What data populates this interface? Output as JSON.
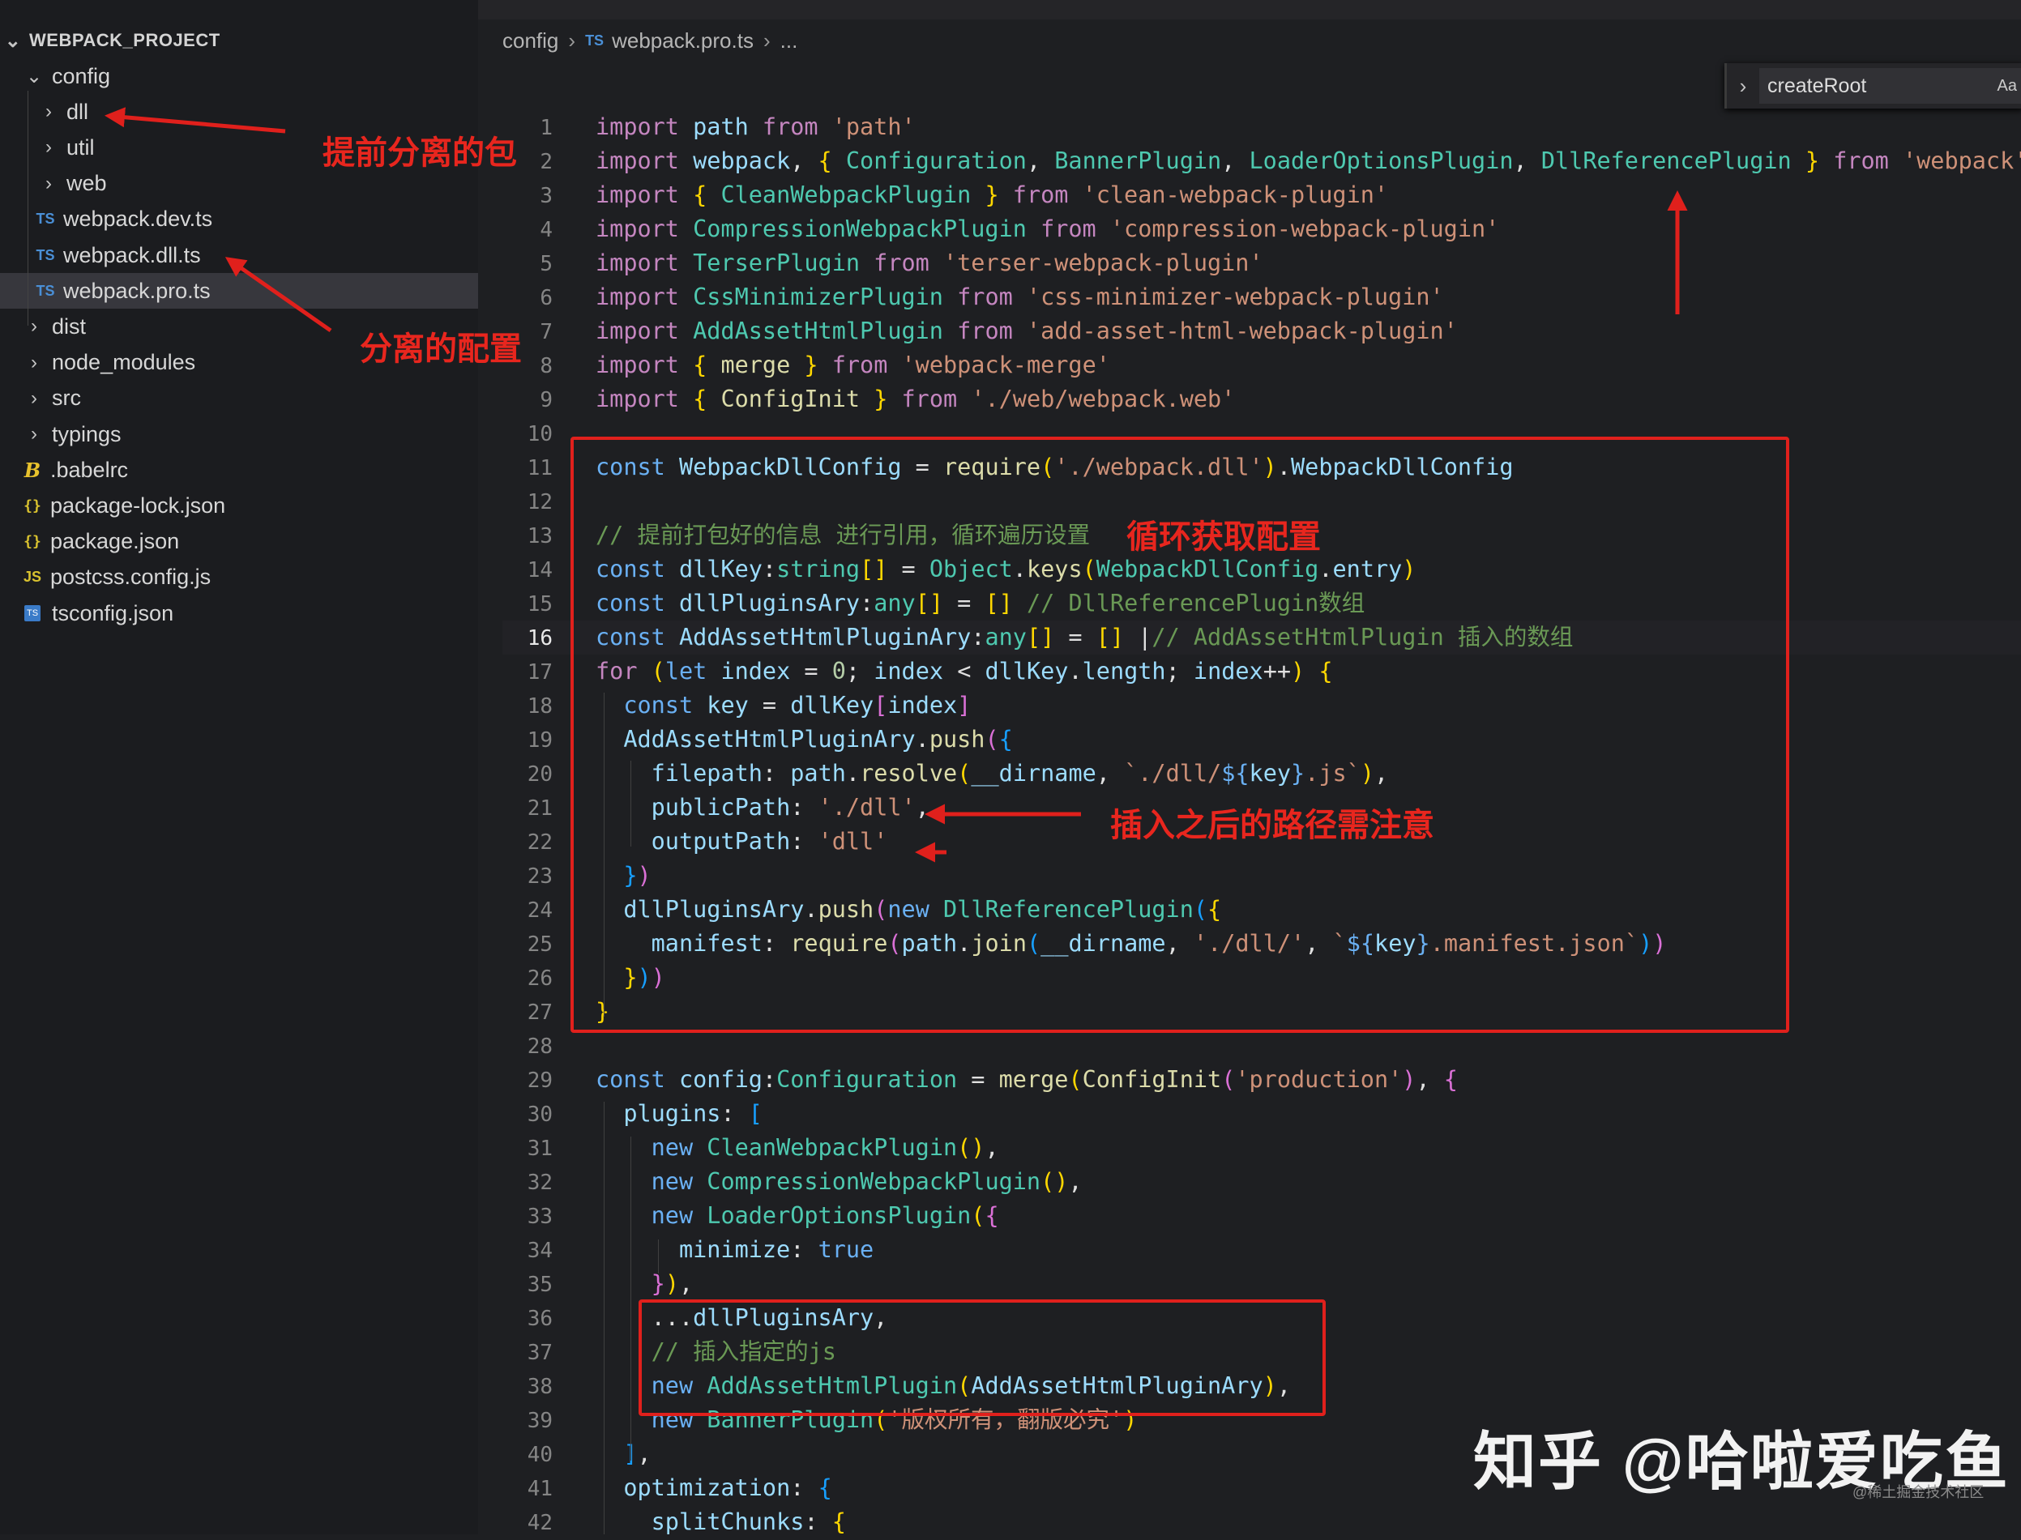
{
  "explorer": {
    "project_title": "WEBPACK_PROJECT",
    "items": [
      {
        "label": "config",
        "kind": "folder",
        "open": true,
        "depth": 0
      },
      {
        "label": "dll",
        "kind": "folder",
        "open": false,
        "depth": 1
      },
      {
        "label": "util",
        "kind": "folder",
        "open": false,
        "depth": 1
      },
      {
        "label": "web",
        "kind": "folder",
        "open": false,
        "depth": 1
      },
      {
        "label": "webpack.dev.ts",
        "kind": "ts",
        "icon": "TS",
        "depth": 1
      },
      {
        "label": "webpack.dll.ts",
        "kind": "ts",
        "icon": "TS",
        "depth": 1
      },
      {
        "label": "webpack.pro.ts",
        "kind": "ts",
        "icon": "TS",
        "depth": 1,
        "selected": true
      },
      {
        "label": "dist",
        "kind": "folder",
        "open": false,
        "depth": 0
      },
      {
        "label": "node_modules",
        "kind": "folder",
        "open": false,
        "depth": 0
      },
      {
        "label": "src",
        "kind": "folder",
        "open": false,
        "depth": 0
      },
      {
        "label": "typings",
        "kind": "folder",
        "open": false,
        "depth": 0
      },
      {
        "label": ".babelrc",
        "kind": "babel",
        "icon": "B",
        "depth": 0
      },
      {
        "label": "package-lock.json",
        "kind": "json",
        "icon": "{}",
        "depth": 0
      },
      {
        "label": "package.json",
        "kind": "json",
        "icon": "{}",
        "depth": 0
      },
      {
        "label": "postcss.config.js",
        "kind": "js",
        "icon": "JS",
        "depth": 0
      },
      {
        "label": "tsconfig.json",
        "kind": "tsconfig",
        "icon": "TS",
        "depth": 0
      }
    ]
  },
  "breadcrumb": {
    "folder": "config",
    "file_icon": "TS",
    "file": "webpack.pro.ts",
    "more": "..."
  },
  "find": {
    "value": "createRoot",
    "match_case": "Aa"
  },
  "code_lines": [
    [
      [
        "im",
        "import "
      ],
      [
        "var",
        "path "
      ],
      [
        "im",
        "from "
      ],
      [
        "str",
        "'path'"
      ]
    ],
    [
      [
        "im",
        "import "
      ],
      [
        "var",
        "webpack"
      ],
      [
        "pl",
        ", "
      ],
      [
        "b1",
        "{ "
      ],
      [
        "cls",
        "Configuration"
      ],
      [
        "pl",
        ", "
      ],
      [
        "cls",
        "BannerPlugin"
      ],
      [
        "pl",
        ", "
      ],
      [
        "cls",
        "LoaderOptionsPlugin"
      ],
      [
        "pl",
        ", "
      ],
      [
        "cls",
        "DllReferencePlugin"
      ],
      [
        "b1",
        " } "
      ],
      [
        "im",
        "from "
      ],
      [
        "str",
        "'webpack'"
      ]
    ],
    [
      [
        "im",
        "import "
      ],
      [
        "b1",
        "{ "
      ],
      [
        "cls",
        "CleanWebpackPlugin"
      ],
      [
        "b1",
        " } "
      ],
      [
        "im",
        "from "
      ],
      [
        "str",
        "'clean-webpack-plugin'"
      ]
    ],
    [
      [
        "im",
        "import "
      ],
      [
        "cls",
        "CompressionWebpackPlugin "
      ],
      [
        "im",
        "from "
      ],
      [
        "str",
        "'compression-webpack-plugin'"
      ]
    ],
    [
      [
        "im",
        "import "
      ],
      [
        "cls",
        "TerserPlugin "
      ],
      [
        "im",
        "from "
      ],
      [
        "str",
        "'terser-webpack-plugin'"
      ]
    ],
    [
      [
        "im",
        "import "
      ],
      [
        "cls",
        "CssMinimizerPlugin "
      ],
      [
        "im",
        "from "
      ],
      [
        "str",
        "'css-minimizer-webpack-plugin'"
      ]
    ],
    [
      [
        "im",
        "import "
      ],
      [
        "cls",
        "AddAssetHtmlPlugin "
      ],
      [
        "im",
        "from "
      ],
      [
        "str",
        "'add-asset-html-webpack-plugin'"
      ]
    ],
    [
      [
        "im",
        "import "
      ],
      [
        "b1",
        "{ "
      ],
      [
        "fn",
        "merge"
      ],
      [
        "b1",
        " } "
      ],
      [
        "im",
        "from "
      ],
      [
        "str",
        "'webpack-merge'"
      ]
    ],
    [
      [
        "im",
        "import "
      ],
      [
        "b1",
        "{ "
      ],
      [
        "fn",
        "ConfigInit"
      ],
      [
        "b1",
        " } "
      ],
      [
        "im",
        "from "
      ],
      [
        "str",
        "'./web/webpack.web'"
      ]
    ],
    [],
    [
      [
        "kw",
        "const "
      ],
      [
        "var",
        "WebpackDllConfig"
      ],
      [
        "pl",
        " = "
      ],
      [
        "fn",
        "require"
      ],
      [
        "b1",
        "("
      ],
      [
        "str",
        "'./webpack.dll'"
      ],
      [
        "b1",
        ")"
      ],
      [
        "pl",
        "."
      ],
      [
        "var",
        "WebpackDllConfig"
      ]
    ],
    [],
    [
      [
        "cm",
        "// 提前打包好的信息 进行引用，循环遍历设置"
      ]
    ],
    [
      [
        "kw",
        "const "
      ],
      [
        "var",
        "dllKey"
      ],
      [
        "pl",
        ":"
      ],
      [
        "typ",
        "string"
      ],
      [
        "b1",
        "[]"
      ],
      [
        "pl",
        " = "
      ],
      [
        "cls",
        "Object"
      ],
      [
        "pl",
        "."
      ],
      [
        "fn",
        "keys"
      ],
      [
        "b1",
        "("
      ],
      [
        "cls",
        "WebpackDllConfig"
      ],
      [
        "pl",
        "."
      ],
      [
        "var",
        "entry"
      ],
      [
        "b1",
        ")"
      ]
    ],
    [
      [
        "kw",
        "const "
      ],
      [
        "var",
        "dllPluginsAry"
      ],
      [
        "pl",
        ":"
      ],
      [
        "typ",
        "any"
      ],
      [
        "b1",
        "[]"
      ],
      [
        "pl",
        " = "
      ],
      [
        "b1",
        "[] "
      ],
      [
        "cm",
        "// DllReferencePlugin数组"
      ]
    ],
    [
      [
        "kw",
        "const "
      ],
      [
        "var",
        "AddAssetHtmlPluginAry"
      ],
      [
        "pl",
        ":"
      ],
      [
        "typ",
        "any"
      ],
      [
        "b1",
        "[]"
      ],
      [
        "pl",
        " = "
      ],
      [
        "b1",
        "[] "
      ],
      [
        "pl",
        "|"
      ],
      [
        "cm",
        "// AddAssetHtmlPlugin 插入的数组"
      ]
    ],
    [
      [
        "kwc",
        "for "
      ],
      [
        "b1",
        "("
      ],
      [
        "kw",
        "let "
      ],
      [
        "var",
        "index"
      ],
      [
        "pl",
        " = "
      ],
      [
        "num",
        "0"
      ],
      [
        "pl",
        "; "
      ],
      [
        "var",
        "index"
      ],
      [
        "pl",
        " < "
      ],
      [
        "var",
        "dllKey"
      ],
      [
        "pl",
        "."
      ],
      [
        "var",
        "length"
      ],
      [
        "pl",
        "; "
      ],
      [
        "var",
        "index"
      ],
      [
        "pl",
        "++"
      ],
      [
        "b1",
        ") {"
      ]
    ],
    [
      [
        "pl",
        "  "
      ],
      [
        "kw",
        "const "
      ],
      [
        "var",
        "key"
      ],
      [
        "pl",
        " = "
      ],
      [
        "var",
        "dllKey"
      ],
      [
        "b2",
        "["
      ],
      [
        "var",
        "index"
      ],
      [
        "b2",
        "]"
      ]
    ],
    [
      [
        "pl",
        "  "
      ],
      [
        "var",
        "AddAssetHtmlPluginAry"
      ],
      [
        "pl",
        "."
      ],
      [
        "fn",
        "push"
      ],
      [
        "b2",
        "("
      ],
      [
        "b3",
        "{"
      ]
    ],
    [
      [
        "pl",
        "    "
      ],
      [
        "var",
        "filepath"
      ],
      [
        "pl",
        ": "
      ],
      [
        "var",
        "path"
      ],
      [
        "pl",
        "."
      ],
      [
        "fn",
        "resolve"
      ],
      [
        "b1",
        "("
      ],
      [
        "var",
        "__dirname"
      ],
      [
        "pl",
        ", "
      ],
      [
        "str",
        "`./dll/"
      ],
      [
        "kw",
        "${"
      ],
      [
        "var",
        "key"
      ],
      [
        "kw",
        "}"
      ],
      [
        "str",
        ".js`"
      ],
      [
        "b1",
        ")"
      ],
      [
        "pl",
        ","
      ]
    ],
    [
      [
        "pl",
        "    "
      ],
      [
        "var",
        "publicPath"
      ],
      [
        "pl",
        ": "
      ],
      [
        "str",
        "'./dll'"
      ],
      [
        "pl",
        ","
      ]
    ],
    [
      [
        "pl",
        "    "
      ],
      [
        "var",
        "outputPath"
      ],
      [
        "pl",
        ": "
      ],
      [
        "str",
        "'dll'"
      ]
    ],
    [
      [
        "pl",
        "  "
      ],
      [
        "b3",
        "}"
      ],
      [
        "b2",
        ")"
      ]
    ],
    [
      [
        "pl",
        "  "
      ],
      [
        "var",
        "dllPluginsAry"
      ],
      [
        "pl",
        "."
      ],
      [
        "fn",
        "push"
      ],
      [
        "b2",
        "("
      ],
      [
        "kw",
        "new "
      ],
      [
        "cls",
        "DllReferencePlugin"
      ],
      [
        "b3",
        "("
      ],
      [
        "b1",
        "{"
      ]
    ],
    [
      [
        "pl",
        "    "
      ],
      [
        "var",
        "manifest"
      ],
      [
        "pl",
        ": "
      ],
      [
        "fn",
        "require"
      ],
      [
        "b2",
        "("
      ],
      [
        "var",
        "path"
      ],
      [
        "pl",
        "."
      ],
      [
        "fn",
        "join"
      ],
      [
        "b3",
        "("
      ],
      [
        "var",
        "__dirname"
      ],
      [
        "pl",
        ", "
      ],
      [
        "str",
        "'./dll/'"
      ],
      [
        "pl",
        ", "
      ],
      [
        "str",
        "`"
      ],
      [
        "kw",
        "${"
      ],
      [
        "var",
        "key"
      ],
      [
        "kw",
        "}"
      ],
      [
        "str",
        ".manifest.json`"
      ],
      [
        "b3",
        ")"
      ],
      [
        "b2",
        ")"
      ]
    ],
    [
      [
        "pl",
        "  "
      ],
      [
        "b1",
        "}"
      ],
      [
        "b3",
        ")"
      ],
      [
        "b2",
        ")"
      ]
    ],
    [
      [
        "b1",
        "}"
      ]
    ],
    [],
    [
      [
        "kw",
        "const "
      ],
      [
        "var",
        "config"
      ],
      [
        "pl",
        ":"
      ],
      [
        "cls",
        "Configuration"
      ],
      [
        "pl",
        " = "
      ],
      [
        "fn",
        "merge"
      ],
      [
        "b1",
        "("
      ],
      [
        "fn",
        "ConfigInit"
      ],
      [
        "b2",
        "("
      ],
      [
        "str",
        "'production'"
      ],
      [
        "b2",
        ")"
      ],
      [
        "pl",
        ", "
      ],
      [
        "b2",
        "{"
      ]
    ],
    [
      [
        "pl",
        "  "
      ],
      [
        "var",
        "plugins"
      ],
      [
        "pl",
        ": "
      ],
      [
        "b3",
        "["
      ]
    ],
    [
      [
        "pl",
        "    "
      ],
      [
        "kw",
        "new "
      ],
      [
        "cls",
        "CleanWebpackPlugin"
      ],
      [
        "b1",
        "()"
      ],
      [
        "pl",
        ","
      ]
    ],
    [
      [
        "pl",
        "    "
      ],
      [
        "kw",
        "new "
      ],
      [
        "cls",
        "CompressionWebpackPlugin"
      ],
      [
        "b1",
        "()"
      ],
      [
        "pl",
        ","
      ]
    ],
    [
      [
        "pl",
        "    "
      ],
      [
        "kw",
        "new "
      ],
      [
        "cls",
        "LoaderOptionsPlugin"
      ],
      [
        "b1",
        "("
      ],
      [
        "b2",
        "{"
      ]
    ],
    [
      [
        "pl",
        "      "
      ],
      [
        "var",
        "minimize"
      ],
      [
        "pl",
        ": "
      ],
      [
        "kw",
        "true"
      ]
    ],
    [
      [
        "pl",
        "    "
      ],
      [
        "b2",
        "}"
      ],
      [
        "b1",
        ")"
      ],
      [
        "pl",
        ","
      ]
    ],
    [
      [
        "pl",
        "    ..."
      ],
      [
        "var",
        "dllPluginsAry"
      ],
      [
        "pl",
        ","
      ]
    ],
    [
      [
        "pl",
        "    "
      ],
      [
        "cm",
        "// 插入指定的js"
      ]
    ],
    [
      [
        "pl",
        "    "
      ],
      [
        "kw",
        "new "
      ],
      [
        "cls",
        "AddAssetHtmlPlugin"
      ],
      [
        "b1",
        "("
      ],
      [
        "var",
        "AddAssetHtmlPluginAry"
      ],
      [
        "b1",
        ")"
      ],
      [
        "pl",
        ","
      ]
    ],
    [
      [
        "pl",
        "    "
      ],
      [
        "kw",
        "new "
      ],
      [
        "cls",
        "BannerPlugin"
      ],
      [
        "b1",
        "("
      ],
      [
        "str",
        "'版权所有，翻版必究'"
      ],
      [
        "b1",
        ")"
      ]
    ],
    [
      [
        "pl",
        "  "
      ],
      [
        "b3",
        "]"
      ],
      [
        "pl",
        ","
      ]
    ],
    [
      [
        "pl",
        "  "
      ],
      [
        "var",
        "optimization"
      ],
      [
        "pl",
        ": "
      ],
      [
        "b3",
        "{"
      ]
    ],
    [
      [
        "pl",
        "    "
      ],
      [
        "var",
        "splitChunks"
      ],
      [
        "pl",
        ": "
      ],
      [
        "b1",
        "{"
      ]
    ]
  ],
  "active_line": 16,
  "annotations": {
    "dll_label": "提前分离的包",
    "config_label": "分离的配置",
    "loop_label": "循环获取配置",
    "path_label": "插入之后的路径需注意"
  },
  "watermark": {
    "main": "知乎 @哈啦爱吃鱼",
    "sub": "@稀土掘金技术社区"
  }
}
